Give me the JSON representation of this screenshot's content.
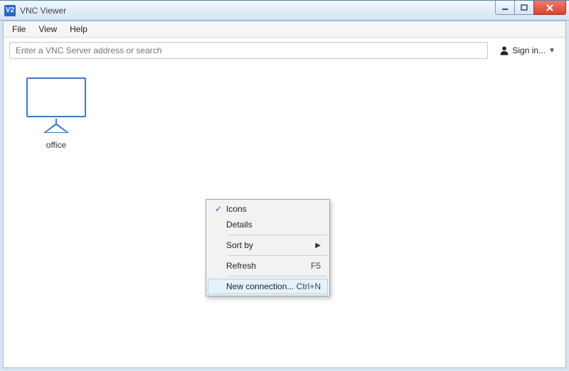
{
  "window": {
    "title": "VNC Viewer",
    "app_icon_text": "V2"
  },
  "menubar": {
    "file": "File",
    "view": "View",
    "help": "Help"
  },
  "search": {
    "placeholder": "Enter a VNC Server address or search"
  },
  "signin": {
    "label": "Sign in..."
  },
  "connections": [
    {
      "label": "office"
    }
  ],
  "context_menu": {
    "icons": {
      "label": "Icons",
      "checked": true
    },
    "details": {
      "label": "Details"
    },
    "sort_by": {
      "label": "Sort by"
    },
    "refresh": {
      "label": "Refresh",
      "accel": "F5"
    },
    "new_connection": {
      "label": "New connection...",
      "accel": "Ctrl+N"
    }
  }
}
